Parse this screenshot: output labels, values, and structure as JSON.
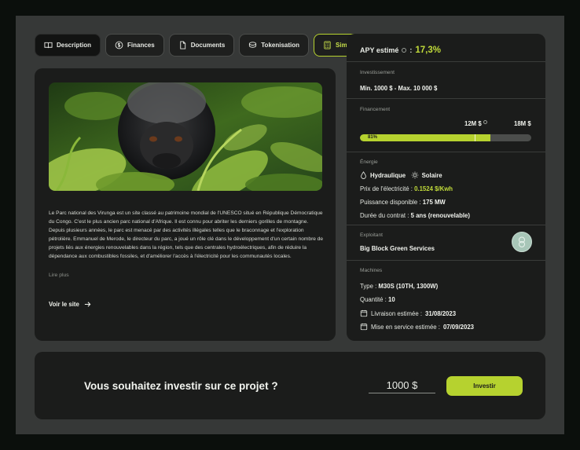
{
  "tabs": [
    {
      "label": "Description",
      "icon": "book-icon"
    },
    {
      "label": "Finances",
      "icon": "dollar-icon"
    },
    {
      "label": "Documents",
      "icon": "document-icon"
    },
    {
      "label": "Tokenisation",
      "icon": "coins-icon"
    },
    {
      "label": "Simulation",
      "icon": "calculator-icon"
    }
  ],
  "description": {
    "text": "Le Parc national des Virunga est un site classé au patrimoine mondial de l'UNESCO situé en République Démocratique du Congo.  C'est le plus ancien parc national d'Afrique. Il est connu pour abriter les derniers gorilles de montagne. Depuis plusieurs années, le parc est menacé par des activités illégales telles que le braconnage et l'exploration pétrolière. Emmanuel de Merode, le directeur du parc, a joué un rôle clé dans le développement d'un certain nombre de projets liés aux énergies renouvelables dans la région, tels que des centrales hydroélectriques, afin de réduire la dépendance aux combustibles fossiles, et d'améliorer l'accès à l'électricité pour les communautés locales.",
    "read_more": "Lire plus",
    "visit": "Voir le site"
  },
  "apy": {
    "label": "APY estimé",
    "colon": ":",
    "value": "17,3%"
  },
  "investissement": {
    "label": "Investissement",
    "range": "Min. 1000 $ - Max. 10 000 $"
  },
  "financement": {
    "label": "Financement",
    "current": "12M $",
    "total": "18M $",
    "percent_label": "81%",
    "fill_fraction": 0.76,
    "marker_fraction": 0.67
  },
  "energie": {
    "label": "Énergie",
    "type1": "Hydraulique",
    "type2": "Solaire",
    "price_label": "Prix de l'électricité :",
    "price_value": "0.1524 $/Kwh",
    "power_label": "Puissance disponible :",
    "power_value": "175 MW",
    "duration_label": "Durée du contrat :",
    "duration_value": "5 ans (renouvelable)"
  },
  "exploitant": {
    "label": "Exploitant",
    "name": "Big Block Green Services"
  },
  "machines": {
    "label": "Machines",
    "type_label": "Type :",
    "type_value": "M30S (10TH, 1300W)",
    "qty_label": "Quantité :",
    "qty_value": "10",
    "delivery_label": "Livraison estimée :",
    "delivery_value": "31/08/2023",
    "service_label": "Mise en service estimée :",
    "service_value": "07/09/2023"
  },
  "invest": {
    "question": "Vous souhaitez investir sur ce projet ?",
    "amount": "1000 $",
    "button": "Investir"
  },
  "colors": {
    "accent": "#b6d22f",
    "card": "#1b1c1b",
    "frame": "#363837"
  }
}
